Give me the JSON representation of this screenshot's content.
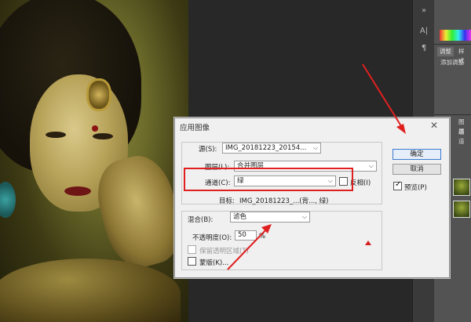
{
  "panels": {
    "tabs": [
      "调整",
      "样式"
    ],
    "add_adjustment": "添加调整",
    "side_tabs": [
      "A|",
      "¶"
    ],
    "lower_tabs": [
      "图层",
      "通道"
    ]
  },
  "dialog": {
    "title": "应用图像",
    "close": "✕",
    "source": {
      "label": "源(S):",
      "value": "IMG_20181223_20154..."
    },
    "layer": {
      "label": "图层(L):",
      "value": "合并图层"
    },
    "channel": {
      "label": "通道(C):",
      "value": "绿",
      "invert_label": "反相(I)"
    },
    "target": {
      "label": "目标:",
      "value": "IMG_20181223_...(背..., 绿)"
    },
    "blending": {
      "label": "混合(B):",
      "value": "滤色",
      "opacity_label": "不透明度(O):",
      "opacity_value": "50",
      "opacity_unit": "%",
      "preserve_label": "保留透明区域(T)",
      "mask_label": "蒙版(K)..."
    },
    "ok_label": "确定",
    "cancel_label": "取消",
    "preview_label": "预览(P)",
    "preview_checked": true
  },
  "colors": {
    "annotation": "#e02020",
    "accent": "#3a7ad0"
  }
}
